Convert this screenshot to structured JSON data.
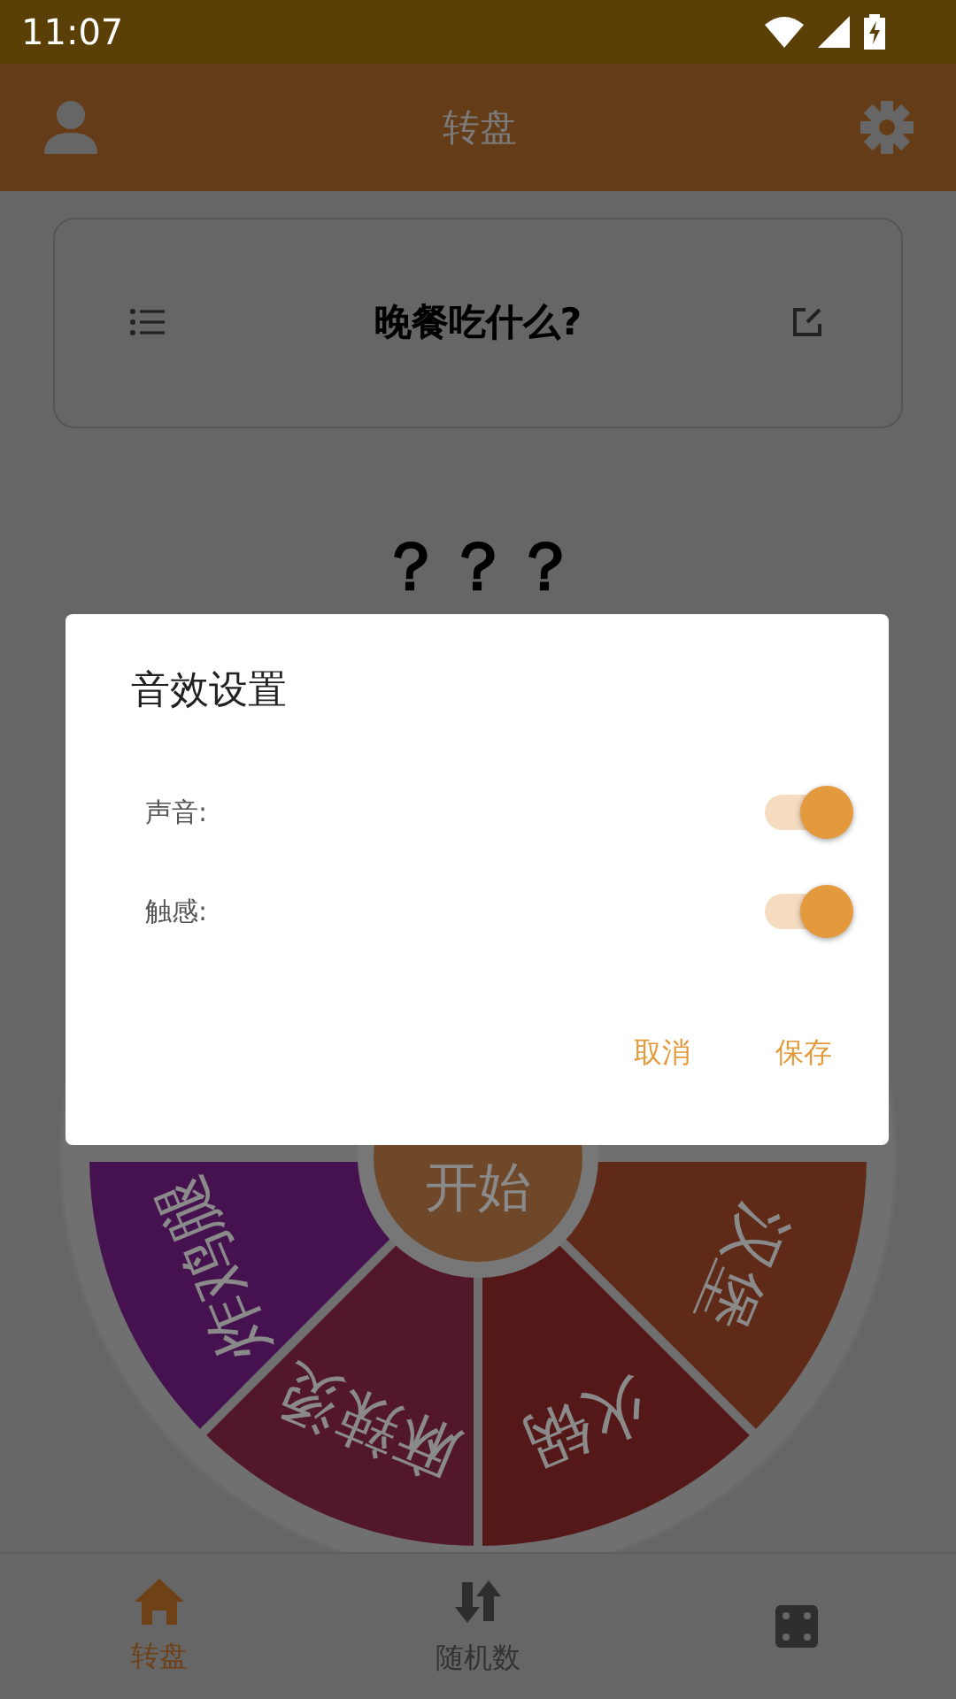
{
  "status_bar": {
    "time": "11:07"
  },
  "app_bar": {
    "title": "转盘"
  },
  "topic": {
    "title": "晚餐吃什么?"
  },
  "result": "？？？",
  "wheel": {
    "button": "开始",
    "segments": [
      {
        "label": "炸鸡腿",
        "color": "#45124f"
      },
      {
        "label": "麻辣烫",
        "color": "#52182a"
      },
      {
        "label": "火锅",
        "color": "#541818"
      },
      {
        "label": "汉堡",
        "color": "#5f2a18"
      }
    ]
  },
  "bottom_nav": {
    "items": [
      {
        "label": "转盘",
        "selected": true
      },
      {
        "label": "随机数",
        "selected": false
      },
      {
        "selected": false
      }
    ]
  },
  "dialog": {
    "title": "音效设置",
    "options": [
      {
        "label": "声音:",
        "on": true
      },
      {
        "label": "触感:",
        "on": true
      }
    ],
    "buttons": [
      "取消",
      "保存"
    ]
  }
}
